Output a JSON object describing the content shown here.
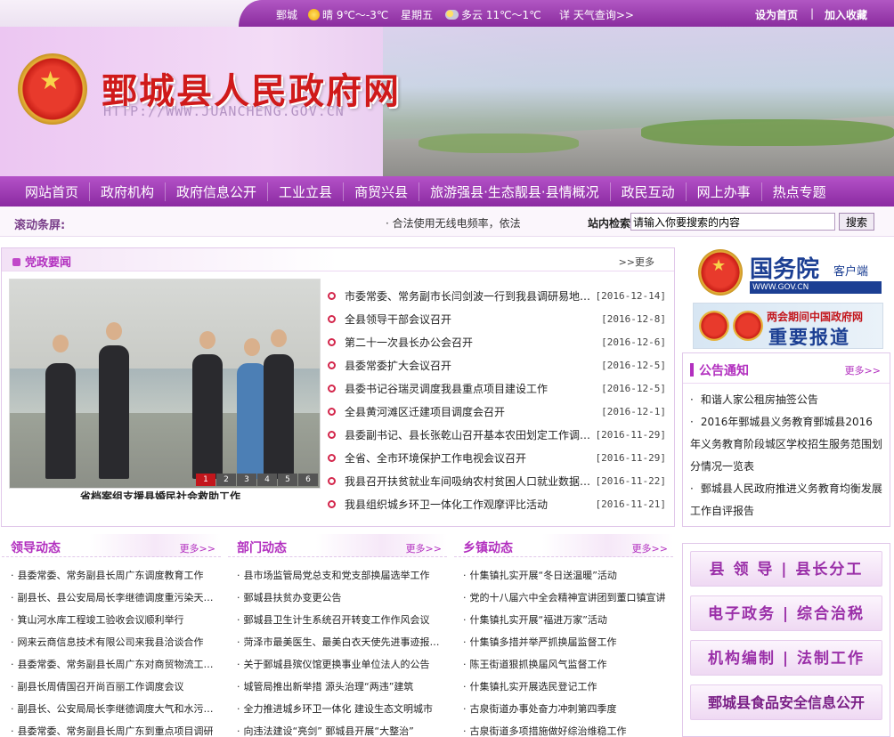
{
  "topbar": {
    "city": "鄄城",
    "weather_today": "晴 9℃～-3℃",
    "weekday": "星期五",
    "weather_tomorrow": "多云 11℃～1℃",
    "detail": "详  天气查询>>",
    "set_home": "设为首页",
    "separator": "|",
    "favorite": "加入收藏"
  },
  "banner": {
    "title": "鄄城县人民政府网",
    "url": "HTTP://WWW.JUANCHENG.GOV.CN"
  },
  "nav": [
    "网站首页",
    "政府机构",
    "政府信息公开",
    "工业立县",
    "商贸兴县",
    "旅游强县·生态靓县·县情概况",
    "政民互动",
    "网上办事",
    "热点专题"
  ],
  "scroll": {
    "label": "滚动条屏:",
    "text": "·  合法使用无线电频率，依法"
  },
  "search": {
    "label": "站内检索",
    "placeholder": "请输入你要搜索的内容",
    "button": "搜索"
  },
  "main_news": {
    "title": "党政要闻",
    "more": ">>更多",
    "photo_caption": "省档案组支援县婚民社会救助工作",
    "pager": [
      "1",
      "2",
      "3",
      "4",
      "5",
      "6"
    ],
    "items": [
      {
        "title": "市委常委、常务副市长闫剑波一行到我县调研易地扶贫搬迁工作",
        "date": "[2016-12-14]"
      },
      {
        "title": "全县领导干部会议召开",
        "date": "[2016-12-8]"
      },
      {
        "title": "第二十一次县长办公会召开",
        "date": "[2016-12-6]"
      },
      {
        "title": "县委常委扩大会议召开",
        "date": "[2016-12-5]"
      },
      {
        "title": "县委书记谷瑞灵调度我县重点项目建设工作",
        "date": "[2016-12-5]"
      },
      {
        "title": "全县黄河滩区迁建项目调度会召开",
        "date": "[2016-12-1]"
      },
      {
        "title": "县委副书记、县长张乾山召开基本农田划定工作调度会",
        "date": "[2016-11-29]"
      },
      {
        "title": "全省、全市环境保护工作电视会议召开",
        "date": "[2016-11-29]"
      },
      {
        "title": "我县召开扶贫就业车间吸纳农村贫困人口就业数据统计会",
        "date": "[2016-11-22]"
      },
      {
        "title": "我县组织城乡环卫一体化工作观摩评比活动",
        "date": "[2016-11-21]"
      }
    ]
  },
  "gov_app": {
    "name": "国务院",
    "sub": "客户端",
    "url": "WWW.GOV.CN"
  },
  "lianghui": {
    "line1": "两会期间中国政府网",
    "line2": "重要报道"
  },
  "notice": {
    "title": "公告通知",
    "more": "更多>>",
    "items": [
      "和谐人家公租房抽签公告",
      "2016年鄄城县义务教育鄄城县2016年义务教育阶段城区学校招生服务范围划分情况一览表",
      "鄄城县人民政府推进义务教育均衡发展工作自评报告"
    ]
  },
  "quick_links": [
    "县 领 导 | 县长分工",
    "电子政务 | 综合治税",
    "机构编制 | 法制工作",
    "鄄城县食品安全信息公开"
  ],
  "columns": [
    {
      "title": "领导动态",
      "more": "更多>>",
      "items": [
        "县委常委、常务副县长周广东调度教育工作",
        "副县长、县公安局局长李继德调度重污染天气应对工作",
        "箕山河水库工程竣工验收会议顺利举行",
        "网来云商信息技术有限公司来我县洽谈合作",
        "县委常委、常务副县长周广东对商贸物流工作进行调度",
        "副县长周倩国召开尚百丽工作调度会议",
        "副县长、公安局局长李继德调度大气和水污染防治工作",
        "县委常委、常务副县长周广东到重点项目调研"
      ]
    },
    {
      "title": "部门动态",
      "more": "更多>>",
      "items": [
        "县市场监管局党总支和党支部换届选举工作",
        "鄄城县扶贫办变更公告",
        "鄄城县卫生计生系统召开转变工作作风会议",
        "菏泽市最美医生、最美白衣天使先进事迹报告会",
        "关于鄄城县殡仪馆更换事业单位法人的公告",
        "城管局推出新举措 源头治理“两违”建筑",
        "全力推进城乡环卫一体化 建设生态文明城市",
        "向违法建设“亮剑” 鄄城县开展“大整治”"
      ]
    },
    {
      "title": "乡镇动态",
      "more": "更多>>",
      "items": [
        "什集镇扎实开展“冬日送温暖”活动",
        "党的十八届六中全会精神宣讲团到董口镇宣讲",
        "什集镇扎实开展“福进万家”活动",
        "什集镇多措并举严抓换届监督工作",
        "陈王街道狠抓换届风气监督工作",
        "什集镇扎实开展选民登记工作",
        "古泉街道办事处奋力冲刺第四季度",
        "古泉街道多项措施做好综治维稳工作"
      ]
    }
  ]
}
